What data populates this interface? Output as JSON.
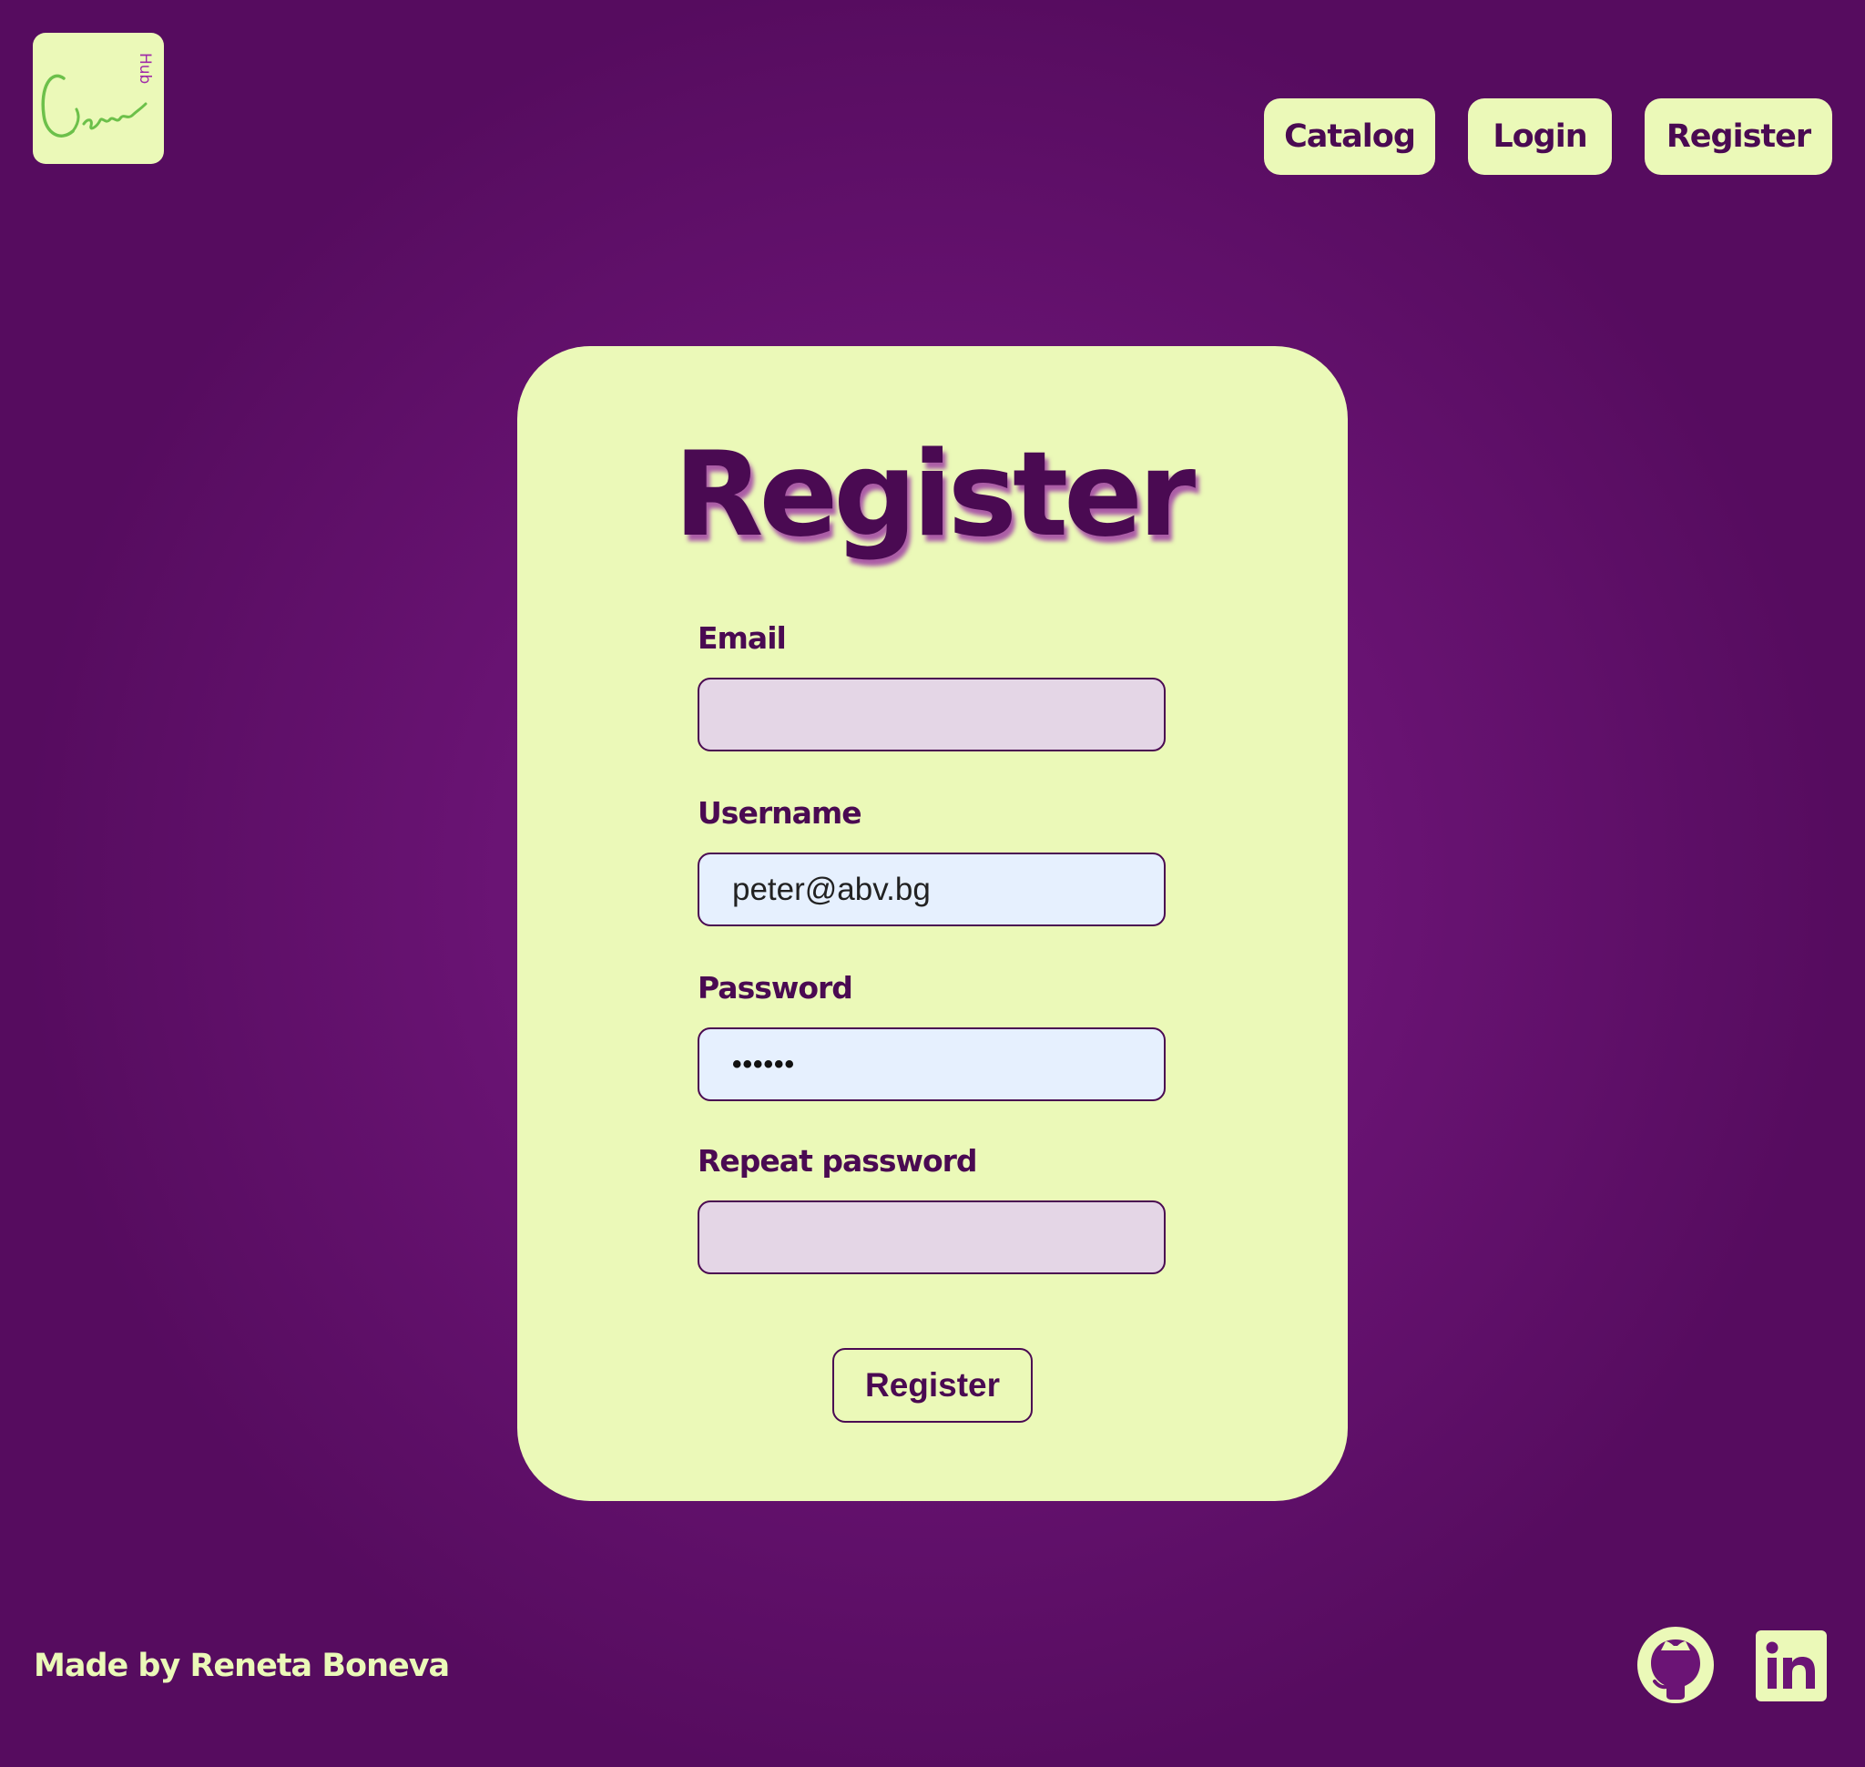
{
  "header": {
    "logo": {
      "text": "Game",
      "subtext": "Hub",
      "icon": "game-hub-logo",
      "text_color": "#6cc04a",
      "subtext_color": "#a02aa8"
    },
    "nav": [
      {
        "label": "Catalog"
      },
      {
        "label": "Login"
      },
      {
        "label": "Register"
      }
    ]
  },
  "form": {
    "title": "Register",
    "fields": [
      {
        "label": "Email",
        "value": "",
        "state": "empty"
      },
      {
        "label": "Username",
        "value": "peter@abv.bg",
        "state": "autofilled"
      },
      {
        "label": "Password",
        "value": "••••••",
        "state": "autofilled"
      },
      {
        "label": "Repeat password",
        "value": "",
        "state": "empty"
      }
    ],
    "submit_label": "Register"
  },
  "footer": {
    "credit": "Made by Reneta Boneva",
    "links": [
      {
        "icon": "github-icon"
      },
      {
        "icon": "linkedin-icon"
      }
    ]
  },
  "colors": {
    "background": "#6b1475",
    "accent": "#ebf9b8",
    "text_dark": "#4a0a52",
    "input_empty": "#e4d6e6",
    "input_autofill": "#e6f0fe"
  }
}
